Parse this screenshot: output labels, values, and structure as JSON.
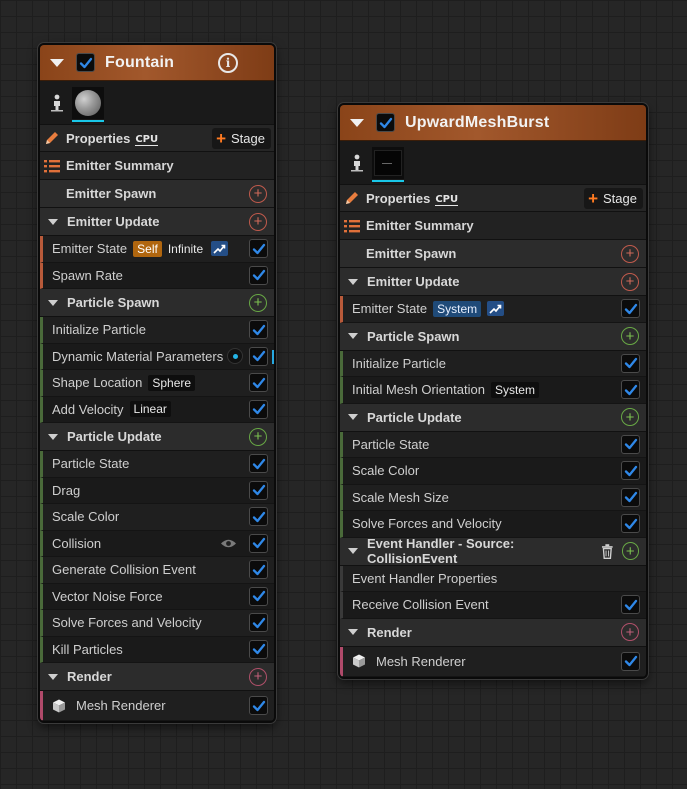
{
  "colors": {
    "header_gradient": "#a2582c",
    "check_blue": "#2f88e8",
    "stage_orange": "#ff7a21",
    "self_tag": "#b0660f",
    "system_tag": "#1f4a78",
    "thumb_underline": "#19c7e8"
  },
  "emitters": [
    {
      "title": "Fountain",
      "icons": [
        "collapse-arrow",
        "checkbox-checked",
        "info-icon",
        "person-icon",
        "sphere-thumbnail"
      ],
      "properties_label": "Properties",
      "sim_target": "CPU",
      "stage_label": "Stage",
      "summary_label": "Emitter Summary",
      "emitter_spawn": "Emitter Spawn",
      "emitter_update": {
        "label": "Emitter Update",
        "modules": [
          {
            "label": "Emitter State",
            "tags": [
              "Self",
              "Infinite"
            ],
            "graph_icon": true
          },
          {
            "label": "Spawn Rate"
          }
        ]
      },
      "particle_spawn": {
        "label": "Particle Spawn",
        "modules": [
          {
            "label": "Initialize Particle"
          },
          {
            "label": "Dynamic Material Parameters",
            "extra_icon": "dot-icon"
          },
          {
            "label": "Shape Location",
            "tag": "Sphere"
          },
          {
            "label": "Add Velocity",
            "tag": "Linear"
          }
        ]
      },
      "particle_update": {
        "label": "Particle Update",
        "modules": [
          {
            "label": "Particle State"
          },
          {
            "label": "Drag"
          },
          {
            "label": "Scale Color"
          },
          {
            "label": "Collision",
            "extra_icon": "eye-icon"
          },
          {
            "label": "Generate Collision Event"
          },
          {
            "label": "Vector Noise Force"
          },
          {
            "label": "Solve Forces and Velocity"
          },
          {
            "label": "Kill Particles"
          }
        ]
      },
      "render": {
        "label": "Render",
        "modules": [
          {
            "label": "Mesh Renderer",
            "icon": "cube-icon"
          }
        ]
      }
    },
    {
      "title": "UpwardMeshBurst",
      "icons": [
        "collapse-arrow",
        "checkbox-checked",
        "person-icon",
        "mesh-thumbnail"
      ],
      "properties_label": "Properties",
      "sim_target": "CPU",
      "stage_label": "Stage",
      "summary_label": "Emitter Summary",
      "emitter_spawn": "Emitter Spawn",
      "emitter_update": {
        "label": "Emitter Update",
        "modules": [
          {
            "label": "Emitter State",
            "tags": [
              "System"
            ],
            "graph_icon": true
          }
        ]
      },
      "particle_spawn": {
        "label": "Particle Spawn",
        "modules": [
          {
            "label": "Initialize Particle"
          },
          {
            "label": "Initial Mesh Orientation",
            "tag": "System"
          }
        ]
      },
      "particle_update": {
        "label": "Particle Update",
        "modules": [
          {
            "label": "Particle State"
          },
          {
            "label": "Scale Color"
          },
          {
            "label": "Scale Mesh Size"
          },
          {
            "label": "Solve Forces and Velocity"
          }
        ]
      },
      "event_handler": {
        "label": "Event Handler - Source: CollisionEvent",
        "modules": [
          {
            "label": "Event Handler Properties",
            "no_checkbox": true
          },
          {
            "label": "Receive Collision Event"
          }
        ]
      },
      "render": {
        "label": "Render",
        "modules": [
          {
            "label": "Mesh Renderer",
            "icon": "cube-icon"
          }
        ]
      }
    }
  ]
}
